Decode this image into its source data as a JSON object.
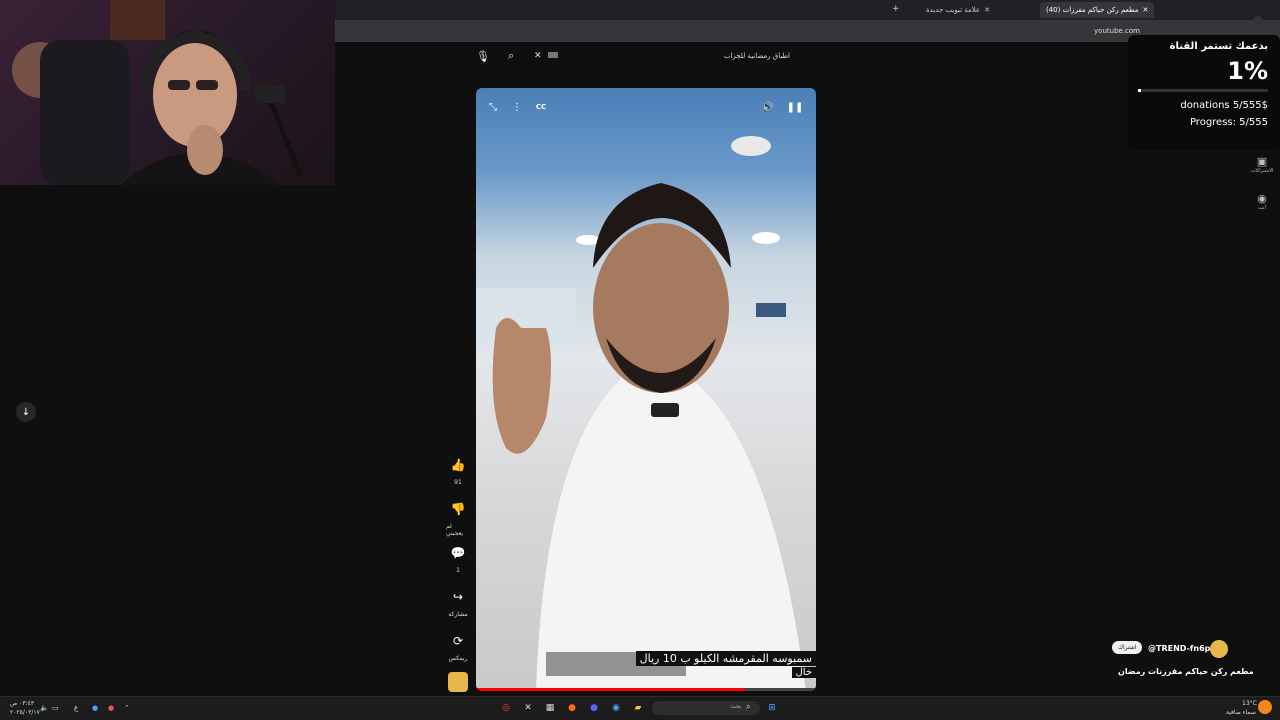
{
  "browser": {
    "tabs": [
      {
        "label": "(40) مطعم ركن حياكم مفرزات",
        "active": true
      },
      {
        "label": "علامة تبويب جديدة",
        "active": false
      }
    ],
    "new_tab": "+",
    "url": "youtube.com"
  },
  "search": {
    "value": "اطباق رمضانية للجزاب",
    "clear": "✕"
  },
  "video": {
    "caption_line1": "سمبوسه المقرمشه الكيلو ب 10 ريال",
    "caption_line2": "خال",
    "progress": 0.79
  },
  "actions": {
    "like_count": "91",
    "dislike_label": "لم يعجبني",
    "comments_count": "1",
    "share_label": "مشاركة",
    "remix_label": "ريمكس"
  },
  "donation": {
    "title": "بدعمك تستمر القناة",
    "percent_text": "1%",
    "percent": 0.01,
    "amount": "donations 5/555$",
    "progress": "Progress: 5/555"
  },
  "rail": {
    "subscriptions_label": "الاشتراكات",
    "you_label": "أنت"
  },
  "channel": {
    "handle": "@TREND-fn6pm",
    "subscribe": "اشتراك",
    "title": "مطعم ركن حياكم مفرزنات رمضان"
  },
  "taskbar": {
    "search_placeholder": "بحث",
    "time": "٠٣:٤٣ ص",
    "date": "٢٠٢٥/٠٣/١٧",
    "lang": "ع",
    "temp": "13°C",
    "weather": "سماء صافية"
  },
  "colors": {
    "accent": "#ff0000",
    "page_bg": "#0f0f0f"
  }
}
